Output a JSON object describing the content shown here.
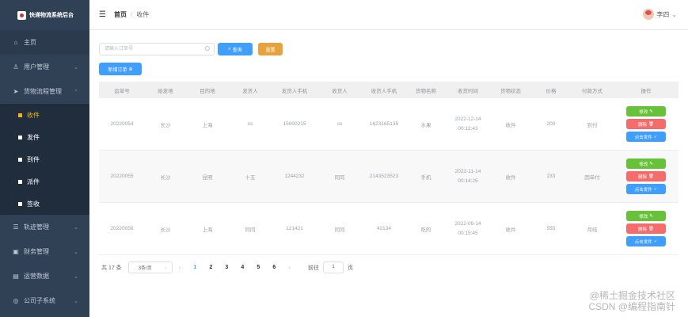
{
  "app": {
    "title": "快递物流系统后台"
  },
  "sidebar": {
    "items": [
      {
        "label": "主页",
        "icon": "home-icon"
      },
      {
        "label": "用户管理",
        "icon": "user-icon"
      },
      {
        "label": "货物流程管理",
        "icon": "send-icon"
      },
      {
        "label": "轨迹管理",
        "icon": "track-icon"
      },
      {
        "label": "财务管理",
        "icon": "finance-icon"
      },
      {
        "label": "运营数据",
        "icon": "chart-icon"
      },
      {
        "label": "公司子系统",
        "icon": "company-icon"
      }
    ],
    "sub_items": [
      {
        "label": "收件"
      },
      {
        "label": "发件"
      },
      {
        "label": "到件"
      },
      {
        "label": "派件"
      },
      {
        "label": "签收"
      }
    ],
    "active_color": "#f0b31a",
    "bg_color": "#304156"
  },
  "header": {
    "breadcrumb_home": "首页",
    "breadcrumb_sep": "/",
    "breadcrumb_current": "收件",
    "user_name": "李四"
  },
  "toolbar": {
    "search_placeholder": "请输入订单号",
    "query_label": "查询",
    "reset_label": "重置",
    "new_order_label": "新增订单"
  },
  "table": {
    "headers": [
      "运单号",
      "始发地",
      "目的地",
      "发货人",
      "发货人手机",
      "收货人",
      "收货人手机",
      "货物名称",
      "收货时间",
      "货物状态",
      "价格",
      "付款方式",
      "操作"
    ],
    "rows": [
      {
        "cells": [
          "20220054",
          "长沙",
          "上海",
          "ss",
          "15000215",
          "ss",
          "1623165135",
          "水果",
          "2022-12-14 00:12:43",
          "收件",
          "200",
          "到付"
        ]
      },
      {
        "cells": [
          "20220055",
          "长沙",
          "昆明",
          "十五",
          "1244232",
          "同同",
          "2143523523",
          "手机",
          "2022-11-14 00:14:25",
          "收件",
          "233",
          "因单付"
        ]
      },
      {
        "cells": [
          "20220056",
          "长沙",
          "上海",
          "同同",
          "121421",
          "同同",
          "42134",
          "吃的",
          "2022-09-14 00:15:45",
          "收件",
          "555",
          "月结"
        ]
      }
    ],
    "op_edit": "修改",
    "op_delete": "删除",
    "op_send": "点击发件"
  },
  "pagination": {
    "total_label": "共 17 条",
    "page_size": "3条/页",
    "pages": [
      "1",
      "2",
      "3",
      "4",
      "5",
      "6"
    ],
    "current_page": "1",
    "goto_label": "前往",
    "goto_value": "1",
    "goto_suffix": "页"
  },
  "watermark": {
    "line1": "@稀土掘金技术社区",
    "line2": "CSDN @编程指南针"
  },
  "colors": {
    "primary": "#409eff",
    "success": "#67c23a",
    "danger": "#f56c6c",
    "warning": "#e6a23c"
  }
}
